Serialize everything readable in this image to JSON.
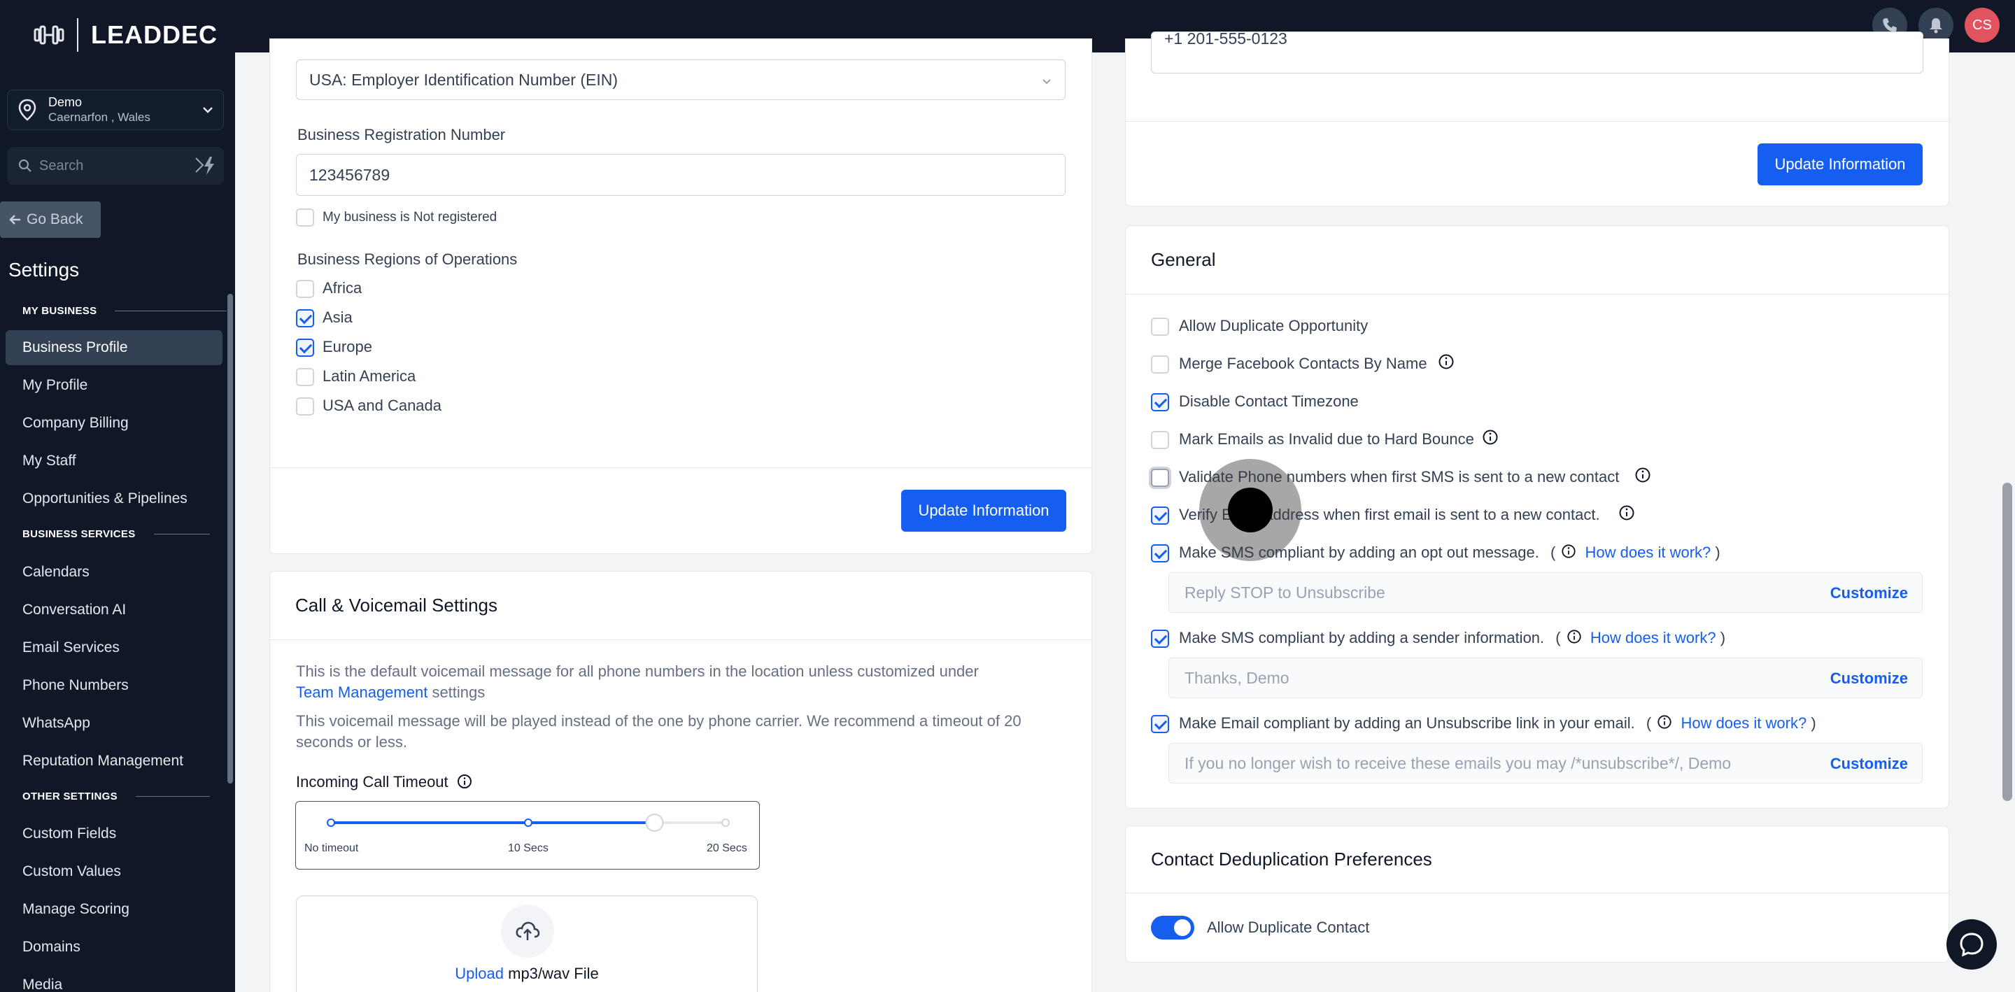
{
  "brand": {
    "name": "LEADDEC"
  },
  "location": {
    "name": "Demo",
    "sub": "Caernarfon , Wales"
  },
  "search": {
    "placeholder": "Search"
  },
  "go_back": "Go Back",
  "settings_title": "Settings",
  "sidebar": {
    "sections": [
      {
        "label": "MY BUSINESS",
        "items": [
          "Business Profile",
          "My Profile",
          "Company Billing",
          "My Staff",
          "Opportunities & Pipelines"
        ]
      },
      {
        "label": "BUSINESS SERVICES",
        "items": [
          "Calendars",
          "Conversation AI",
          "Email Services",
          "Phone Numbers",
          "WhatsApp",
          "Reputation Management"
        ]
      },
      {
        "label": "OTHER SETTINGS",
        "items": [
          "Custom Fields",
          "Custom Values",
          "Manage Scoring",
          "Domains",
          "Media"
        ]
      }
    ],
    "active_item": "Business Profile"
  },
  "topbar": {
    "avatar_initials": "CS",
    "icons": [
      "phone-icon",
      "bell-icon"
    ]
  },
  "business_info": {
    "id_type_selected": "USA: Employer Identification Number (EIN)",
    "reg_number_label": "Business Registration Number",
    "reg_number_value": "123456789",
    "not_registered_label": "My business is Not registered",
    "regions_label": "Business Regions of Operations",
    "regions": [
      {
        "label": "Africa",
        "checked": false
      },
      {
        "label": "Asia",
        "checked": true
      },
      {
        "label": "Europe",
        "checked": true
      },
      {
        "label": "Latin America",
        "checked": false
      },
      {
        "label": "USA and Canada",
        "checked": false
      }
    ],
    "update_button": "Update Information"
  },
  "call_voicemail": {
    "title": "Call & Voicemail Settings",
    "desc1_part1": "This is the default voicemail message for all phone numbers in the location unless customized under",
    "desc1_link": "Team Management",
    "desc1_part2": " settings",
    "desc2": "This voicemail message will be played instead of the one by phone carrier. We recommend a timeout of 20 seconds or less.",
    "timeout_label": "Incoming Call Timeout",
    "slider_labels": [
      "No timeout",
      "10 Secs",
      "20 Secs"
    ],
    "slider_value_fraction": 0.82,
    "upload_link": "Upload",
    "upload_text": " mp3/wav File"
  },
  "phone_card": {
    "phone_value": "+1 201-555-0123",
    "update_button": "Update Information"
  },
  "general": {
    "title": "General",
    "options": [
      {
        "label": "Allow Duplicate Opportunity",
        "checked": false,
        "info": false
      },
      {
        "label": "Merge Facebook Contacts By Name",
        "checked": false,
        "info": true
      },
      {
        "label": "Disable Contact Timezone",
        "checked": true,
        "info": false
      },
      {
        "label": "Mark Emails as Invalid due to Hard Bounce",
        "checked": false,
        "info": true
      },
      {
        "label": "Validate Phone numbers when first SMS is sent to a new contact",
        "checked": false,
        "info": true
      },
      {
        "label": "Verify Email address when first email is sent to a new contact.",
        "checked": true,
        "info": true
      }
    ],
    "compliance": [
      {
        "label": "Make SMS compliant by adding an opt out message.",
        "checked": true,
        "how_link": "How does it work?",
        "box_text": "Reply STOP to Unsubscribe",
        "customize": "Customize"
      },
      {
        "label": "Make SMS compliant by adding a sender information.",
        "checked": true,
        "how_link": "How does it work?",
        "box_text": "Thanks, Demo",
        "customize": "Customize"
      },
      {
        "label": "Make Email compliant by adding an Unsubscribe link in your email.",
        "checked": true,
        "how_link": "How does it work?",
        "box_text": "If you no longer wish to receive these emails you may /*unsubscribe*/, Demo",
        "customize": "Customize"
      }
    ]
  },
  "dedup": {
    "title": "Contact Deduplication Preferences",
    "toggle_label": "Allow Duplicate Contact",
    "toggle_on": true
  },
  "colors": {
    "sidebar_bg": "#101828",
    "primary": "#155eef",
    "avatar": "#e0535f"
  }
}
